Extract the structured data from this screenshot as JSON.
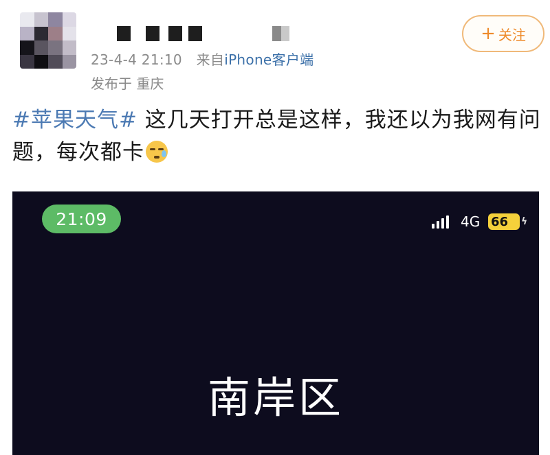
{
  "post": {
    "meta": {
      "date_time": "23-4-4 21:10",
      "source_prefix": "来自",
      "source_device": "iPhone客户端",
      "location": "发布于 重庆"
    },
    "follow_button": {
      "label": "关注"
    },
    "hashtag": "#苹果天气#",
    "text": " 这几天打开总是这样，我还以为我网有问题，每次都卡",
    "emoji": "crying-face-emoji"
  },
  "embedded_screenshot": {
    "status_bar": {
      "time": "21:09",
      "network": "4G",
      "battery": "66"
    },
    "city": "南岸区"
  },
  "colors": {
    "hashtag": "#4c7ab3",
    "follow_accent": "#ee8a2a",
    "time_pill": "#5dbb66",
    "battery": "#f5d13b",
    "screenshot_bg": "#0d0c1e"
  }
}
